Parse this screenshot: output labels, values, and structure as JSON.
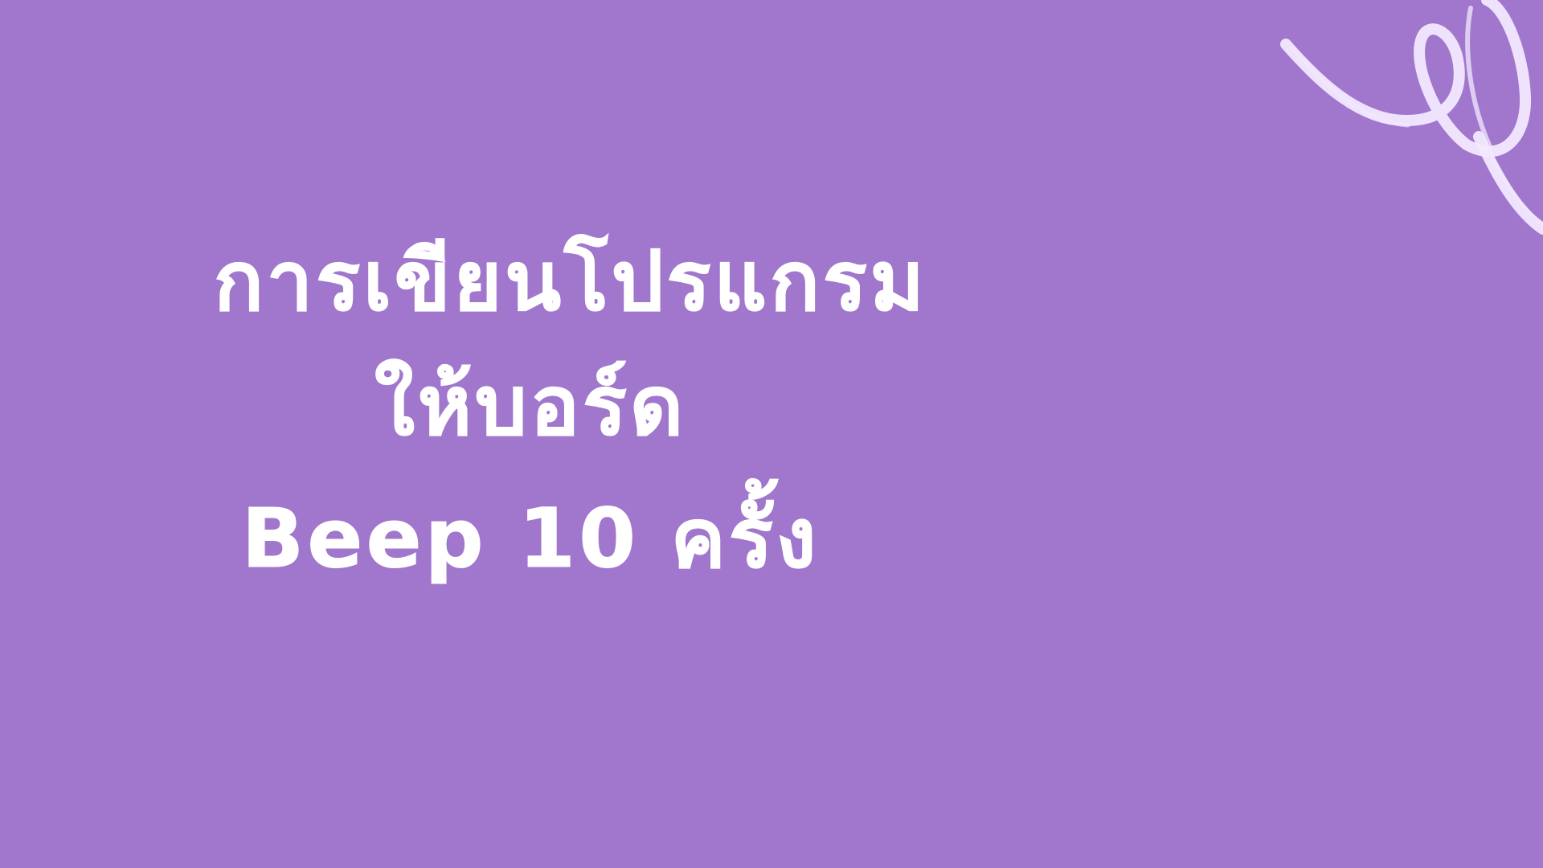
{
  "slide": {
    "title_lines": [
      "การเขียนโปรแกรม",
      "ให้บอร์ด",
      "Beep 10 ครั้ง"
    ],
    "background_color": "#a077cc",
    "text_color": "#ffffff",
    "decoration": "swirl-doodle",
    "decoration_color": "#f3e8ff"
  }
}
